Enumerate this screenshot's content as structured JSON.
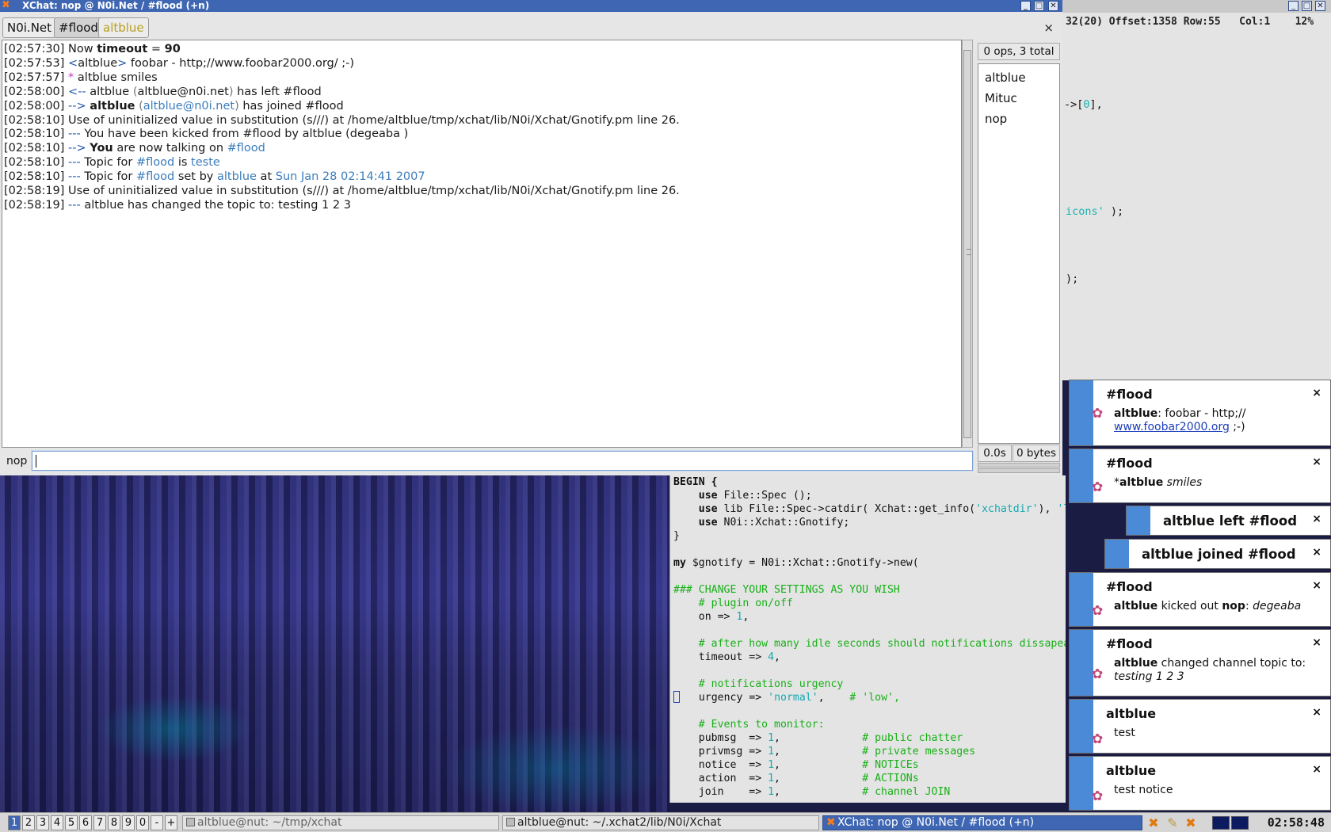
{
  "xchat": {
    "title": "XChat: nop @ N0i.Net / #flood (+n)",
    "tabs": [
      "N0i.Net",
      "#flood",
      "altblue"
    ],
    "tab_close": "×",
    "log": [
      [
        {
          "t": "[02:57:30] Now "
        },
        {
          "t": "timeout",
          "c": "b"
        },
        {
          "t": " = "
        },
        {
          "t": "90",
          "c": "b"
        }
      ],
      [
        {
          "t": "[02:57:53] "
        },
        {
          "t": "<",
          "c": "blu"
        },
        {
          "t": "altblue"
        },
        {
          "t": ">",
          "c": "blu"
        },
        {
          "t": " foobar - http;//www.foobar2000.org/ ;-)"
        }
      ],
      [
        {
          "t": "[02:57:57] "
        },
        {
          "t": "*",
          "c": "mag"
        },
        {
          "t": " altblue smiles"
        }
      ],
      [
        {
          "t": "[02:58:00] "
        },
        {
          "t": "<--",
          "c": "blu"
        },
        {
          "t": " altblue "
        },
        {
          "t": "(",
          "c": "grey"
        },
        {
          "t": "altblue@n0i.net"
        },
        {
          "t": ")",
          "c": "grey"
        },
        {
          "t": " has left #flood"
        }
      ],
      [
        {
          "t": "[02:58:00] "
        },
        {
          "t": "-->",
          "c": "blu"
        },
        {
          "t": " "
        },
        {
          "t": "altblue",
          "c": "b"
        },
        {
          "t": " "
        },
        {
          "t": "(",
          "c": "grey"
        },
        {
          "t": "altblue@n0i.net",
          "c": "lnk"
        },
        {
          "t": ")",
          "c": "grey"
        },
        {
          "t": " has joined #flood"
        }
      ],
      [
        {
          "t": "[02:58:10] Use of uninitialized value in substitution (s///) at /home/altblue/tmp/xchat/lib/N0i/Xchat/Gnotify.pm line 26."
        }
      ],
      [
        {
          "t": "[02:58:10] "
        },
        {
          "t": "---",
          "c": "blu"
        },
        {
          "t": " You have been kicked from #flood by altblue (degeaba )"
        }
      ],
      [
        {
          "t": "[02:58:10] "
        },
        {
          "t": "-->",
          "c": "blu"
        },
        {
          "t": " "
        },
        {
          "t": "You",
          "c": "b"
        },
        {
          "t": " are now talking on "
        },
        {
          "t": "#flood",
          "c": "lnk"
        }
      ],
      [
        {
          "t": "[02:58:10] "
        },
        {
          "t": "---",
          "c": "blu"
        },
        {
          "t": " Topic for "
        },
        {
          "t": "#flood",
          "c": "lnk"
        },
        {
          "t": " is "
        },
        {
          "t": "teste",
          "c": "lnk"
        }
      ],
      [
        {
          "t": "[02:58:10] "
        },
        {
          "t": "---",
          "c": "blu"
        },
        {
          "t": " Topic for "
        },
        {
          "t": "#flood",
          "c": "lnk"
        },
        {
          "t": " set by "
        },
        {
          "t": "altblue",
          "c": "lnk"
        },
        {
          "t": " at "
        },
        {
          "t": "Sun Jan 28 02:14:41 2007",
          "c": "lnk"
        }
      ],
      [
        {
          "t": "[02:58:19] Use of uninitialized value in substitution (s///) at /home/altblue/tmp/xchat/lib/N0i/Xchat/Gnotify.pm line 26."
        }
      ],
      [
        {
          "t": "[02:58:19] "
        },
        {
          "t": "---",
          "c": "blu"
        },
        {
          "t": " altblue has changed the topic to: testing 1 2 3"
        }
      ]
    ],
    "ops_label": "0 ops, 3 total",
    "users": [
      "altblue",
      "Mituc",
      "nop"
    ],
    "lag": "0.0s",
    "throughput": "0 bytes",
    "nick": "nop",
    "input_value": ""
  },
  "terminal": {
    "status": "32(20) Offset:1358 Row:55   Col:1    12%",
    "frag1": "->[",
    "frag1_num": "0",
    "frag1_end": "],",
    "frag2_str": "icons'",
    "frag2_end": " );",
    "frag3": ");"
  },
  "editor": {
    "lines": [
      [
        {
          "t": "BEGIN {",
          "c": "kw"
        }
      ],
      [
        {
          "t": "    "
        },
        {
          "t": "use",
          "c": "kw"
        },
        {
          "t": " File::Spec ();"
        }
      ],
      [
        {
          "t": "    "
        },
        {
          "t": "use",
          "c": "kw"
        },
        {
          "t": " lib File::Spec->catdir( Xchat::get_info("
        },
        {
          "t": "'xchatdir'",
          "c": "st"
        },
        {
          "t": "), "
        },
        {
          "t": "'lib'",
          "c": "st"
        },
        {
          "t": " );"
        }
      ],
      [
        {
          "t": "    "
        },
        {
          "t": "use",
          "c": "kw"
        },
        {
          "t": " N0i::Xchat::Gnotify;"
        }
      ],
      [
        {
          "t": "}"
        }
      ],
      [
        {
          "t": ""
        }
      ],
      [
        {
          "t": "my",
          "c": "kw"
        },
        {
          "t": " $gnotify = N0i::Xchat::Gnotify->new("
        }
      ],
      [
        {
          "t": ""
        }
      ],
      [
        {
          "t": "### CHANGE YOUR SETTINGS AS YOU WISH",
          "c": "cm"
        }
      ],
      [
        {
          "t": "    "
        },
        {
          "t": "# plugin on/off",
          "c": "cm"
        }
      ],
      [
        {
          "t": "    on => "
        },
        {
          "t": "1",
          "c": "nm"
        },
        {
          "t": ","
        }
      ],
      [
        {
          "t": ""
        }
      ],
      [
        {
          "t": "    "
        },
        {
          "t": "# after how many idle seconds should notifications dissapear",
          "c": "cm"
        }
      ],
      [
        {
          "t": "    timeout => "
        },
        {
          "t": "4",
          "c": "nm"
        },
        {
          "t": ","
        }
      ],
      [
        {
          "t": ""
        }
      ],
      [
        {
          "t": "    "
        },
        {
          "t": "# notifications urgency",
          "c": "cm"
        }
      ],
      [
        {
          "t": "CUR",
          "c": "cur"
        },
        {
          "t": "   urgency => "
        },
        {
          "t": "'normal'",
          "c": "st"
        },
        {
          "t": ",    "
        },
        {
          "t": "# 'low',",
          "c": "cm"
        }
      ],
      [
        {
          "t": ""
        }
      ],
      [
        {
          "t": "    "
        },
        {
          "t": "# Events to monitor:",
          "c": "cm"
        }
      ],
      [
        {
          "t": "    pubmsg  => "
        },
        {
          "t": "1",
          "c": "nm"
        },
        {
          "t": ",             "
        },
        {
          "t": "# public chatter",
          "c": "cm"
        }
      ],
      [
        {
          "t": "    privmsg => "
        },
        {
          "t": "1",
          "c": "nm"
        },
        {
          "t": ",             "
        },
        {
          "t": "# private messages",
          "c": "cm"
        }
      ],
      [
        {
          "t": "    notice  => "
        },
        {
          "t": "1",
          "c": "nm"
        },
        {
          "t": ",             "
        },
        {
          "t": "# NOTICEs",
          "c": "cm"
        }
      ],
      [
        {
          "t": "    action  => "
        },
        {
          "t": "1",
          "c": "nm"
        },
        {
          "t": ",             "
        },
        {
          "t": "# ACTIONs",
          "c": "cm"
        }
      ],
      [
        {
          "t": "    join    => "
        },
        {
          "t": "1",
          "c": "nm"
        },
        {
          "t": ",             "
        },
        {
          "t": "# channel JOIN",
          "c": "cm"
        }
      ]
    ]
  },
  "notifications": [
    {
      "title": "#flood",
      "body_bold": "altblue",
      "body_text": ": foobar - http;//",
      "body_link": "www.foobar2000.org",
      "body_tail": " ;-)"
    },
    {
      "title": "#flood",
      "body_prefix": "*",
      "body_bold": "altblue",
      "body_italic": " smiles"
    },
    {
      "title": "altblue left #flood"
    },
    {
      "title": "altblue joined #flood"
    },
    {
      "title": "#flood",
      "body_bold": "altblue",
      "body_text": " kicked out ",
      "body_bold2": "nop",
      "body_text2": ": ",
      "body_italic": "degeaba"
    },
    {
      "title": "#flood",
      "body_bold": "altblue",
      "body_text": " changed channel topic to:",
      "body_italic": "testing 1 2 3"
    },
    {
      "title": "altblue",
      "body_text": "test"
    },
    {
      "title": "altblue",
      "body_text": "test notice"
    }
  ],
  "notif_close": "×",
  "taskbar": {
    "workspaces": [
      "1",
      "2",
      "3",
      "4",
      "5",
      "6",
      "7",
      "8",
      "9",
      "0",
      "-",
      "+"
    ],
    "active_workspace": "1",
    "tasks": [
      {
        "label": "altblue@nut: ~/tmp/xchat",
        "state": "dim"
      },
      {
        "label": "altblue@nut: ~/.xchat2/lib/N0i/Xchat",
        "state": "normal"
      },
      {
        "label": "XChat: nop @ N0i.Net / #flood (+n)",
        "state": "active"
      }
    ],
    "clock": "02:58:48"
  },
  "colors": {
    "accent": "#3e66b2",
    "notif_strip": "#4a8ad6",
    "link": "#3b7dbc",
    "comment": "#18b018",
    "string": "#18a8b0"
  }
}
